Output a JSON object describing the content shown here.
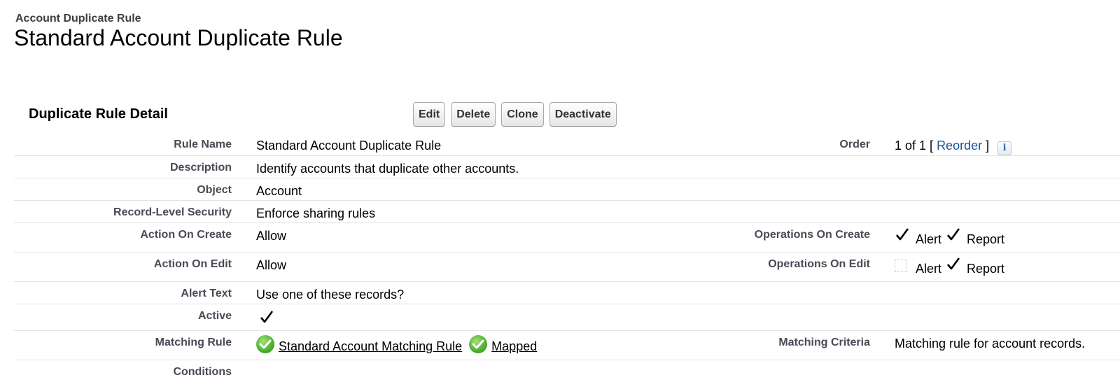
{
  "header": {
    "object_type": "Account Duplicate Rule",
    "record_title": "Standard Account Duplicate Rule"
  },
  "section": {
    "title": "Duplicate Rule Detail"
  },
  "buttons": {
    "edit": "Edit",
    "delete": "Delete",
    "clone": "Clone",
    "deactivate": "Deactivate"
  },
  "fields": {
    "rule_name": {
      "label": "Rule Name",
      "value": "Standard Account Duplicate Rule"
    },
    "order": {
      "label": "Order",
      "value": "1 of 1 [",
      "link": "Reorder",
      "suffix": "]"
    },
    "description": {
      "label": "Description",
      "value": "Identify accounts that duplicate other accounts."
    },
    "object": {
      "label": "Object",
      "value": "Account"
    },
    "record_level_security": {
      "label": "Record-Level Security",
      "value": "Enforce sharing rules"
    },
    "action_on_create": {
      "label": "Action On Create",
      "value": "Allow"
    },
    "operations_on_create": {
      "label": "Operations On Create",
      "alert_label": "Alert",
      "alert_checked": true,
      "report_label": "Report",
      "report_checked": true
    },
    "action_on_edit": {
      "label": "Action On Edit",
      "value": "Allow"
    },
    "operations_on_edit": {
      "label": "Operations On Edit",
      "alert_label": "Alert",
      "alert_checked": false,
      "report_label": "Report",
      "report_checked": true
    },
    "alert_text": {
      "label": "Alert Text",
      "value": "Use one of these records?"
    },
    "active": {
      "label": "Active",
      "checked": true
    },
    "matching_rule": {
      "label": "Matching Rule",
      "value": "Standard Account Matching Rule",
      "status": "Mapped"
    },
    "matching_criteria": {
      "label": "Matching Criteria",
      "value": "Matching rule for account records."
    },
    "conditions": {
      "label": "Conditions",
      "value": ""
    }
  },
  "icons": {
    "info": "info-icon",
    "checkmark": "checkmark-icon",
    "status": "green-check-icon"
  },
  "colors": {
    "link": "#1a5895",
    "label": "#4a4a56",
    "status_green": "#4caf2d"
  }
}
